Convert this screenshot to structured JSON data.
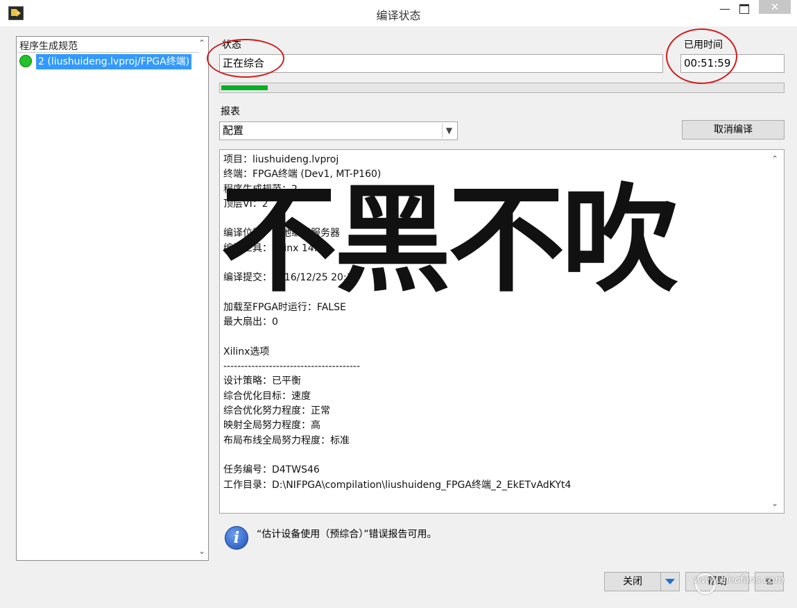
{
  "window": {
    "title": "编译状态",
    "min_glyph": "—",
    "close_glyph": "✕"
  },
  "left_panel": {
    "header": "程序生成规范",
    "items": [
      {
        "label": "2 (liushuideng.lvproj/FPGA终端)",
        "status_color": "#22c22a",
        "selected": true
      }
    ]
  },
  "status": {
    "label": "状态",
    "value": "正在综合"
  },
  "elapsed": {
    "label": "已用时间",
    "value": "00:51:59"
  },
  "progress": {
    "fraction": 0.083
  },
  "report": {
    "label": "报表",
    "selected": "配置",
    "lines": [
      "项目：liushuideng.lvproj",
      "终端：FPGA终端 (Dev1, MT-P160)",
      "程序生成规范：2",
      "顶层VI：2",
      "",
      "编译位置：本地编译服务器",
      "编译工具：Xilinx 14.7",
      "",
      "编译提交：2016/12/25 20:37",
      "",
      "加载至FPGA时运行：FALSE",
      "最大扇出：0",
      "",
      "Xilinx选项",
      "---------------------------------------",
      "设计策略：已平衡",
      "综合优化目标：速度",
      "综合优化努力程度：正常",
      "映射全局努力程度：高",
      "布局布线全局努力程度：标准",
      "",
      "任务编号：D4TWS46",
      "工作目录：D:\\NIFPGA\\compilation\\liushuideng_FPGA终端_2_EkETvAdKYt4"
    ]
  },
  "buttons": {
    "cancel_compile": "取消编译",
    "close": "关闭",
    "help": "帮助",
    "extra": "⧉"
  },
  "info": {
    "icon_text": "i",
    "message": "“估计设备使用（预综合）”错误报告可用。"
  },
  "overlay": {
    "stamp": "不黑不吹",
    "watermark": "www.elecfans.com"
  },
  "colors": {
    "selection": "#3399ff",
    "progress": "#06b025",
    "annotation": "#d11a1a"
  }
}
